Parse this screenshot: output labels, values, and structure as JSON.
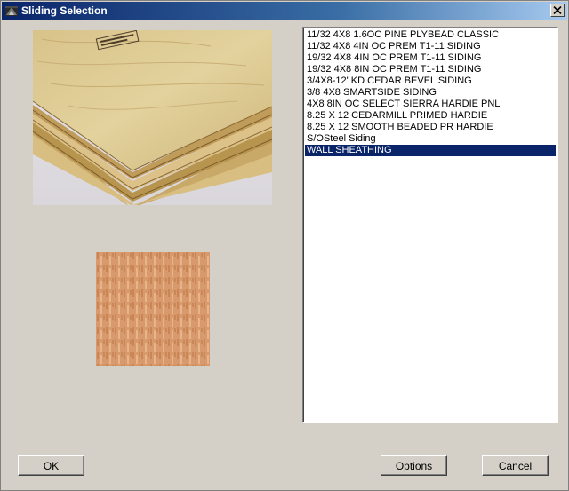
{
  "window": {
    "title": "Sliding Selection"
  },
  "icons": {
    "app": "app-icon",
    "close": "close-icon"
  },
  "preview": {
    "photo_icon": "plywood-photo",
    "swatch_icon": "wood-texture-swatch"
  },
  "siding_list": {
    "items": [
      "11/32 4X8 1.6OC PINE PLYBEAD CLASSIC",
      "11/32 4X8 4IN OC PREM T1-11 SIDING",
      "19/32 4X8 4IN OC PREM T1-11 SIDING",
      "19/32 4X8 8IN OC PREM T1-11 SIDING",
      "3/4X8-12' KD CEDAR BEVEL SIDING",
      "3/8 4X8 SMARTSIDE SIDING",
      "4X8 8IN OC SELECT SIERRA HARDIE PNL",
      "8.25 X 12 CEDARMILL PRIMED HARDIE",
      "8.25 X 12 SMOOTH BEADED PR HARDIE",
      "S/OSteel Siding",
      "WALL SHEATHING"
    ],
    "selected_index": 10
  },
  "buttons": {
    "ok": "OK",
    "options": "Options",
    "cancel": "Cancel"
  },
  "colors": {
    "title_start": "#0a246a",
    "title_end": "#a6caf0",
    "selection": "#0a246a",
    "face": "#d4d0c8"
  }
}
